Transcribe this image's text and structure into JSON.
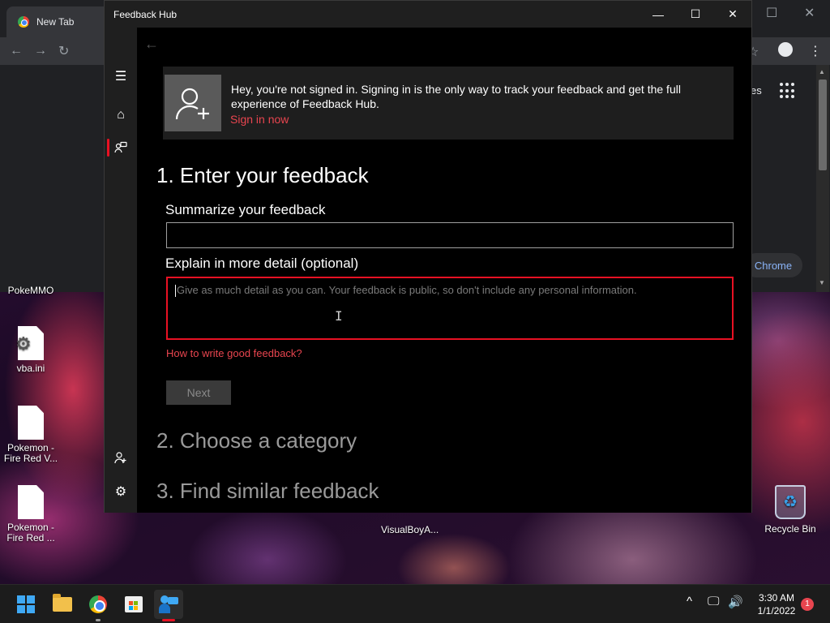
{
  "background_browser": {
    "tab_title": "New Tab",
    "partial_text_right": "es",
    "pill_label": "Chrome"
  },
  "desktop_icons": [
    {
      "label": "PokeMMO"
    },
    {
      "label": "vba.ini"
    },
    {
      "label": "Pokemon - Fire Red V..."
    },
    {
      "label": "Pokemon - Fire Red ..."
    },
    {
      "label": "VisualBoyA..."
    },
    {
      "label": "Recycle Bin"
    }
  ],
  "feedback_hub": {
    "window_title": "Feedback Hub",
    "signin": {
      "message": "Hey, you're not signed in. Signing in is the only way to track your feedback and get the full experience of Feedback Hub.",
      "link": "Sign in now"
    },
    "steps": [
      {
        "label": "1. Enter your feedback",
        "state": "active"
      },
      {
        "label": "2. Choose a category",
        "state": "inactive"
      },
      {
        "label": "3. Find similar feedback",
        "state": "inactive"
      }
    ],
    "summary_label": "Summarize your feedback",
    "summary_value": "",
    "detail_label": "Explain in more detail (optional)",
    "detail_placeholder": "Give as much detail as you can. Your feedback is public, so don't include any personal information.",
    "help_link": "How to write good feedback?",
    "next_button": "Next",
    "accent_color": "#e81123"
  },
  "taskbar": {
    "time": "3:30 AM",
    "date": "1/1/2022",
    "notification_count": "1"
  }
}
